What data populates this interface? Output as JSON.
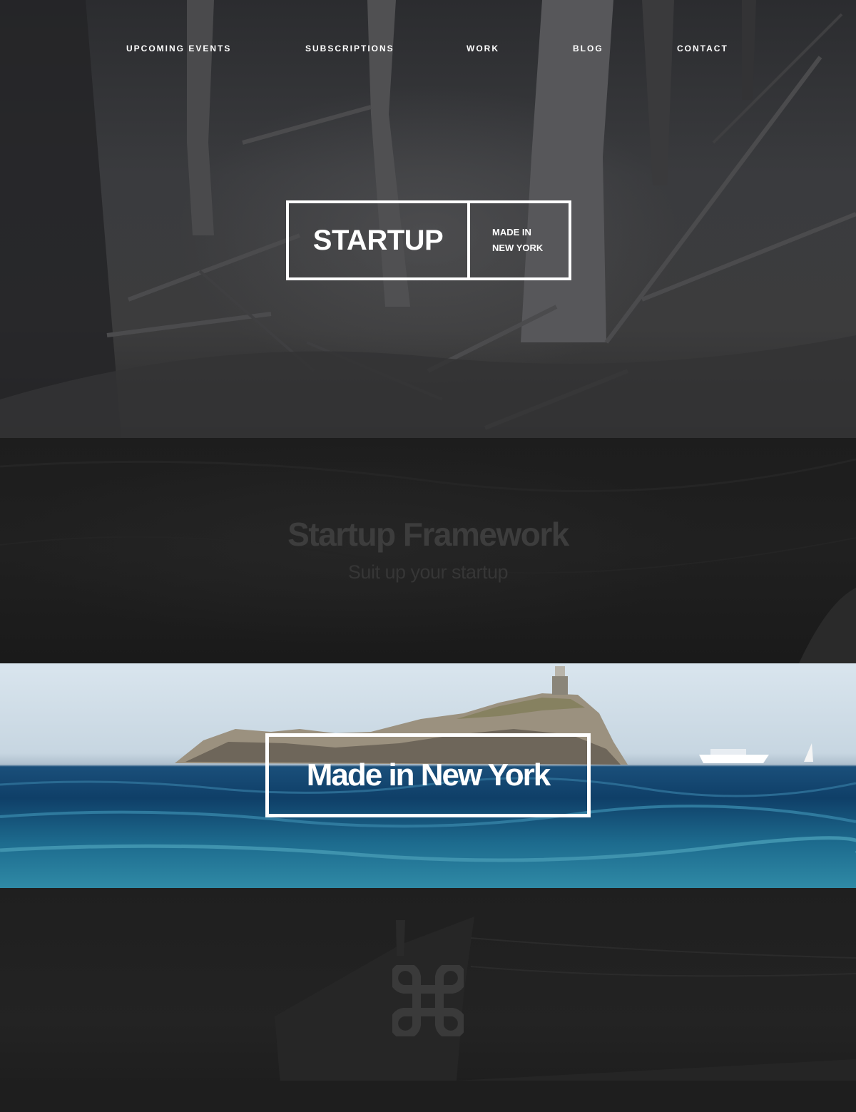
{
  "nav": {
    "items": [
      {
        "label": "UPCOMING EVENTS"
      },
      {
        "label": "SUBSCRIPTIONS"
      },
      {
        "label": "WORK"
      },
      {
        "label": "BLOG"
      },
      {
        "label": "CONTACT"
      }
    ]
  },
  "hero": {
    "logo_main": "STARTUP",
    "logo_sub_line1": "MADE IN",
    "logo_sub_line2": "NEW YORK"
  },
  "framework": {
    "title": "Startup Framework",
    "subtitle": "Suit up your startup"
  },
  "sea": {
    "headline": "Made in New York"
  },
  "ship": {
    "icon": "command-key-icon"
  },
  "colors": {
    "text": "#ffffff",
    "framework_title": "#3d3d3d",
    "framework_subtitle": "#363636",
    "command_icon": "#3a3a3a"
  }
}
